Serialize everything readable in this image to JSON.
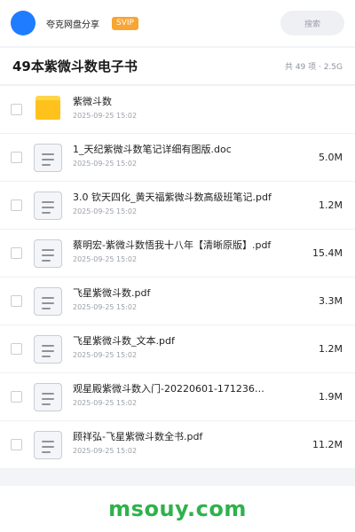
{
  "header": {
    "share_name": "夸克网盘分享",
    "badge": "SVIP",
    "search_placeholder": "搜索"
  },
  "folder": {
    "title": "49本紫微斗数电子书",
    "meta": "共 49 项 · 2.5G"
  },
  "files": [
    {
      "type": "folder",
      "name": "紫微斗数",
      "date": "2025-09-25 15:02",
      "size": ""
    },
    {
      "type": "doc",
      "name": "1_天纪紫微斗数笔记详细有图版.doc",
      "date": "2025-09-25 15:02",
      "size": "5.0M"
    },
    {
      "type": "doc",
      "name": "3.0 钦天四化_黄天福紫微斗数高级班笔记.pdf",
      "date": "2025-09-25 15:02",
      "size": "1.2M"
    },
    {
      "type": "doc",
      "name": "蔡明宏-紫微斗数悟我十八年【清晰原版】.pdf",
      "date": "2025-09-25 15:02",
      "size": "15.4M"
    },
    {
      "type": "doc",
      "name": "飞星紫微斗数.pdf",
      "date": "2025-09-25 15:02",
      "size": "3.3M"
    },
    {
      "type": "doc",
      "name": "飞星紫微斗数_文本.pdf",
      "date": "2025-09-25 15:02",
      "size": "1.2M"
    },
    {
      "type": "doc",
      "name": "观星殿紫微斗数入门-20220601-171236…",
      "date": "2025-09-25 15:02",
      "size": "1.9M"
    },
    {
      "type": "doc",
      "name": "顾祥弘-飞星紫微斗数全书.pdf",
      "date": "2025-09-25 15:02",
      "size": "11.2M"
    }
  ],
  "footer": {
    "brand": "msouy.com"
  },
  "colors": {
    "accent": "#1f7cff",
    "svip": "#f7a533",
    "folder": "#ffc21c",
    "brand": "#2eb24b"
  }
}
